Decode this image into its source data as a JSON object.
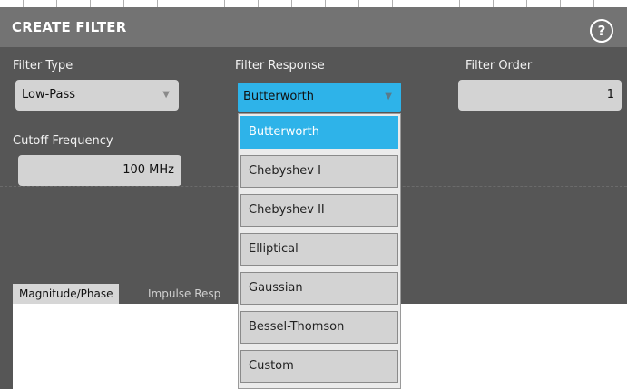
{
  "dialog": {
    "title": "CREATE FILTER",
    "help_icon": "?"
  },
  "filter_type": {
    "label": "Filter Type",
    "value": "Low-Pass"
  },
  "filter_response": {
    "label": "Filter Response",
    "value": "Butterworth",
    "options": [
      "Butterworth",
      "Chebyshev I",
      "Chebyshev II",
      "Elliptical",
      "Gaussian",
      "Bessel-Thomson",
      "Custom"
    ],
    "selected": "Butterworth"
  },
  "filter_order": {
    "label": "Filter Order",
    "value": "1"
  },
  "cutoff": {
    "label": "Cutoff Frequency",
    "value": "100 MHz"
  },
  "tabs": [
    {
      "label": "Magnitude/Phase",
      "active": true
    },
    {
      "label": "Impulse Resp",
      "active": false
    }
  ],
  "colors": {
    "accent": "#2eb3e9",
    "panel": "#565656",
    "titlebar": "#737373",
    "field": "#d3d3d3"
  }
}
